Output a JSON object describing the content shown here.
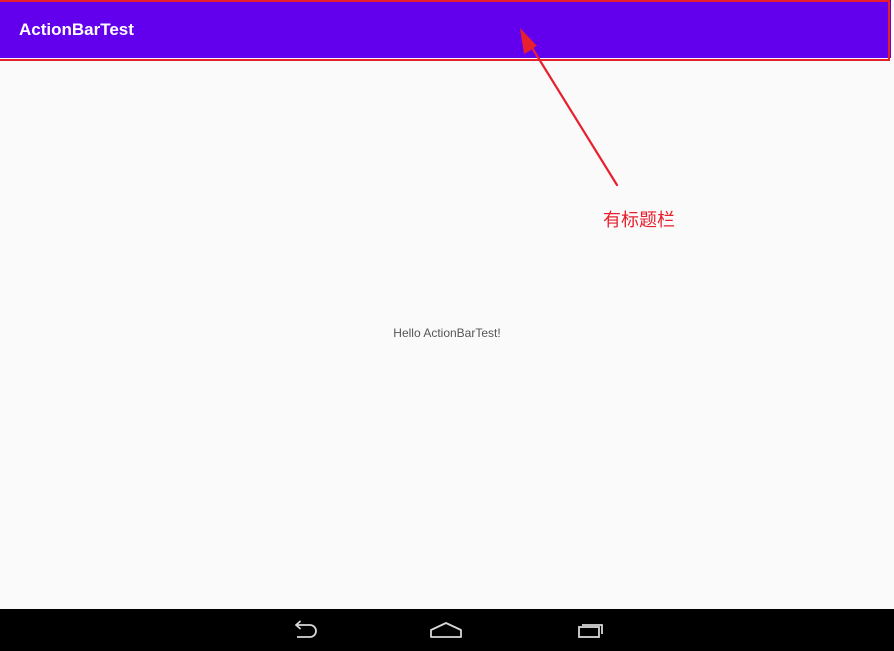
{
  "app": {
    "title": "ActionBarTest",
    "accent_color": "#6200ee",
    "background_color": "#fafafa"
  },
  "content": {
    "message": "Hello ActionBarTest!"
  },
  "annotation": {
    "label": "有标题栏",
    "color": "#e8202e"
  },
  "nav_bar": {
    "buttons": [
      {
        "icon": "back-icon"
      },
      {
        "icon": "home-icon"
      },
      {
        "icon": "recents-icon"
      }
    ]
  }
}
